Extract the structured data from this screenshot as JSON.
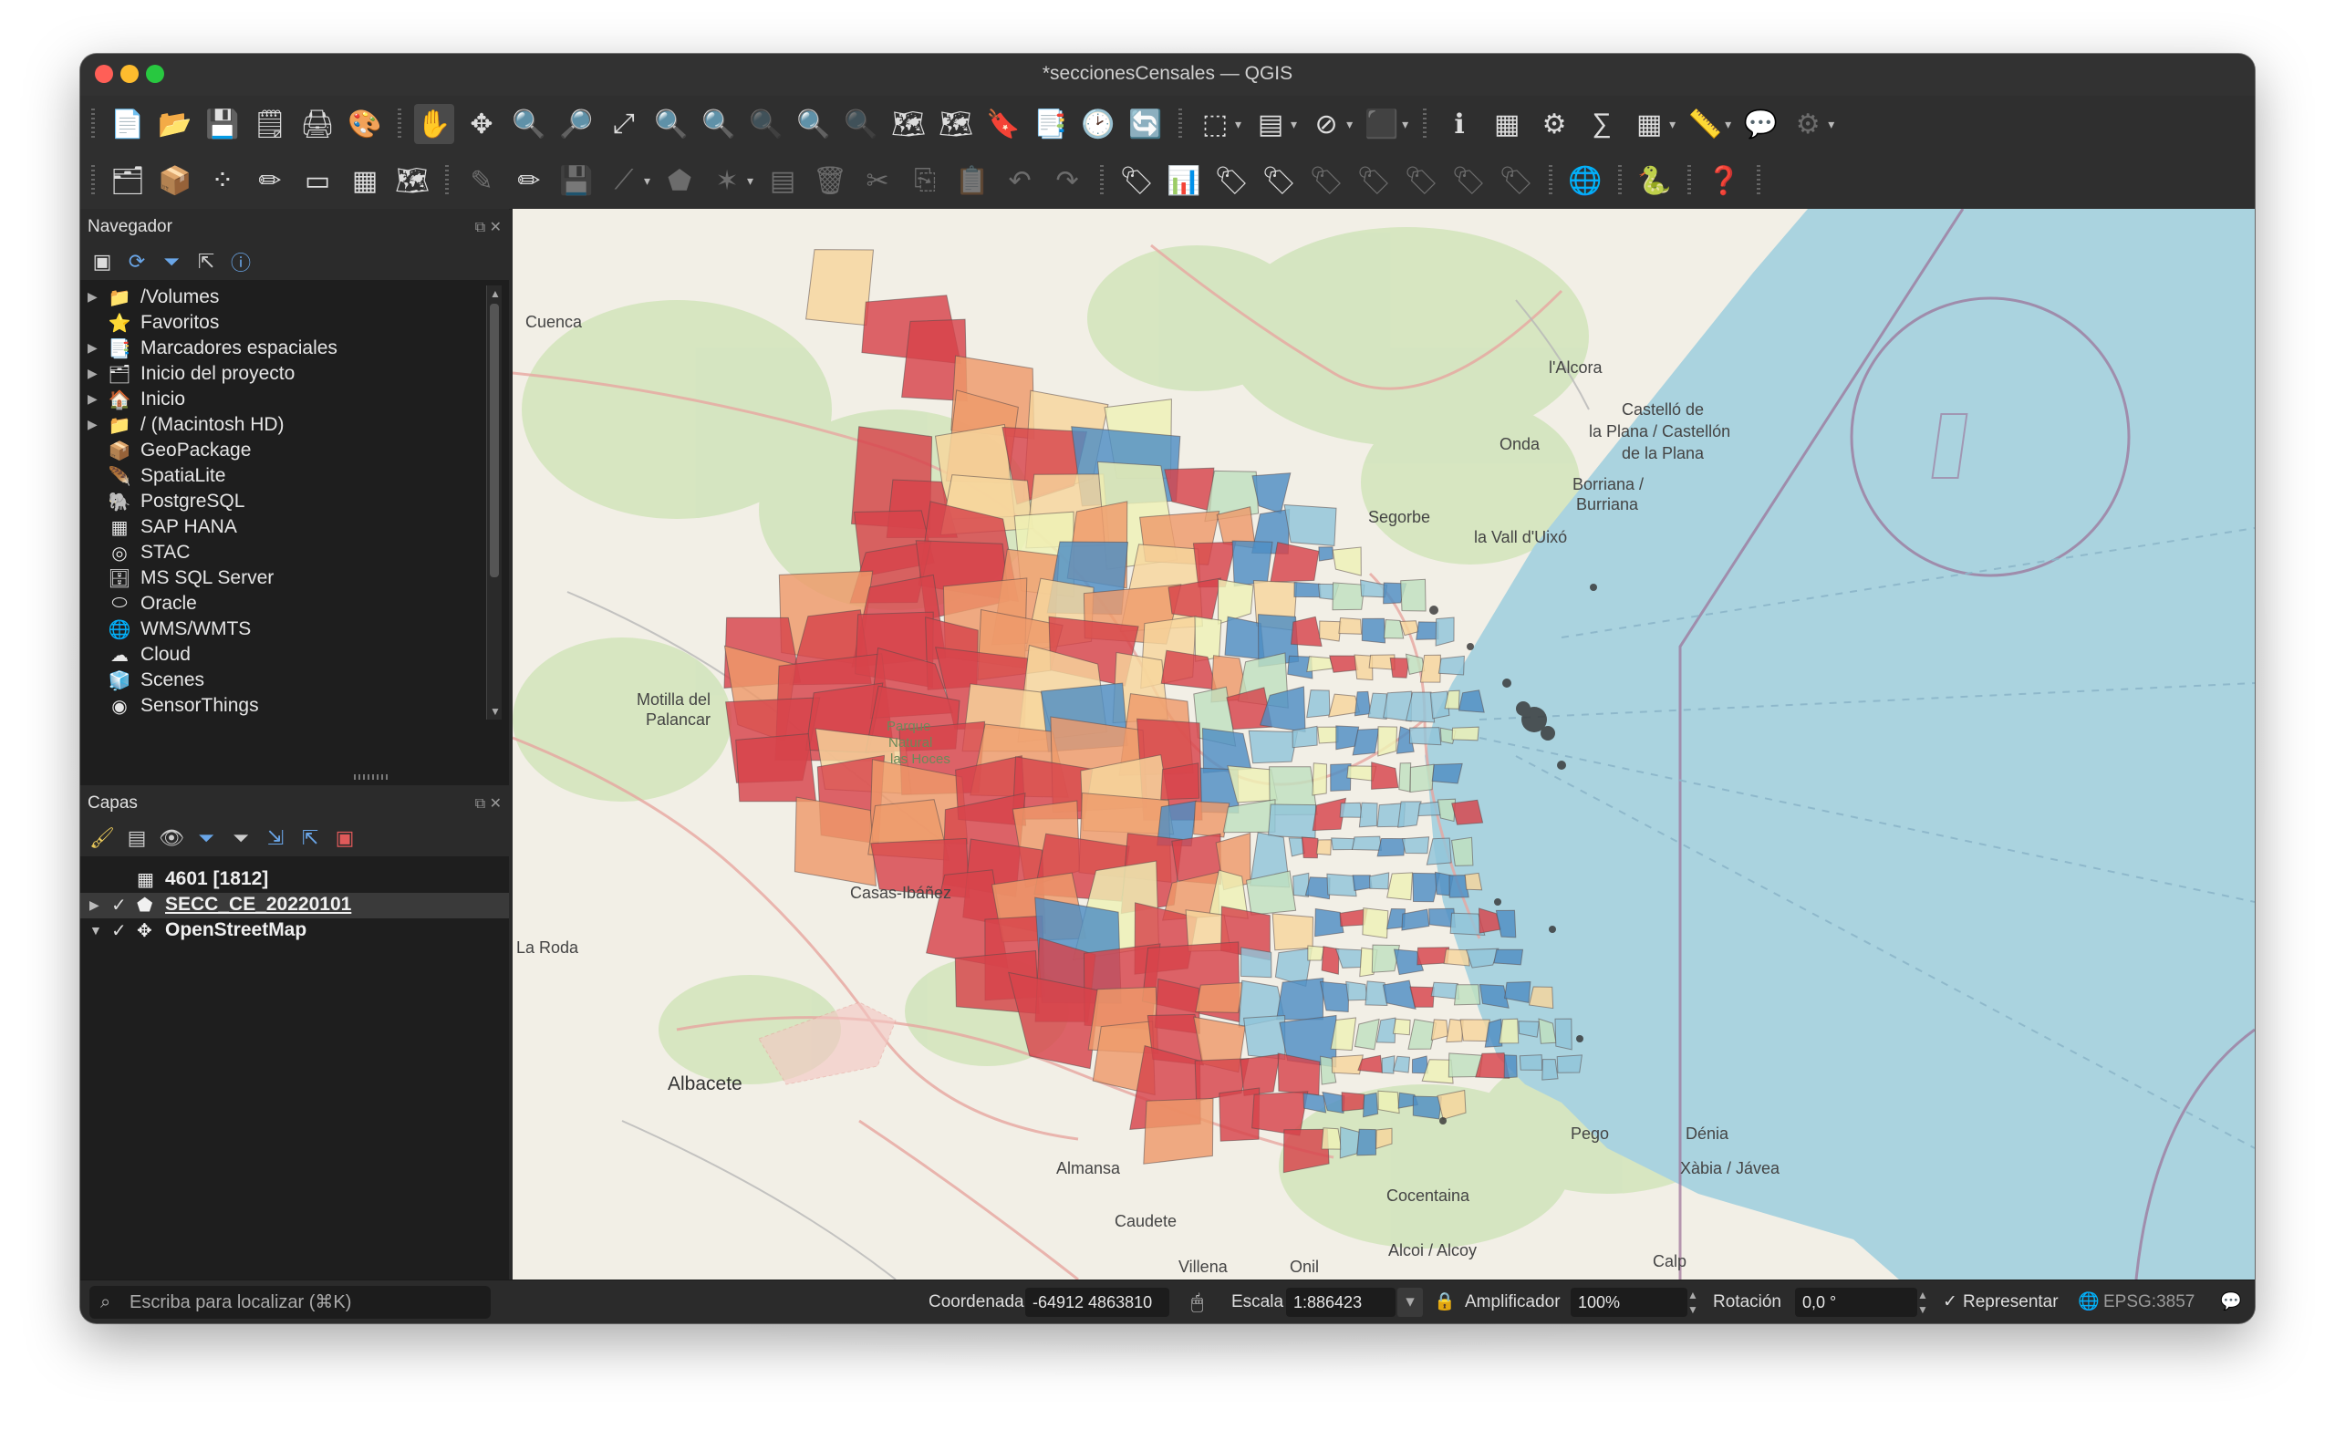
{
  "window": {
    "title": "*seccionesCensales — QGIS"
  },
  "navigator": {
    "title": "Navegador",
    "items": [
      {
        "label": "/Volumes",
        "icon": "folder-icon",
        "expandable": true
      },
      {
        "label": "Favoritos",
        "icon": "star-icon",
        "expandable": false
      },
      {
        "label": "Marcadores espaciales",
        "icon": "bookmark-icon",
        "expandable": true
      },
      {
        "label": "Inicio del proyecto",
        "icon": "project-home-icon",
        "expandable": true
      },
      {
        "label": "Inicio",
        "icon": "home-icon",
        "expandable": true
      },
      {
        "label": "/ (Macintosh HD)",
        "icon": "folder-icon",
        "expandable": true
      },
      {
        "label": "GeoPackage",
        "icon": "geopackage-icon",
        "expandable": false
      },
      {
        "label": "SpatiaLite",
        "icon": "spatialite-icon",
        "expandable": false
      },
      {
        "label": "PostgreSQL",
        "icon": "postgresql-icon",
        "expandable": false
      },
      {
        "label": "SAP HANA",
        "icon": "sap-hana-icon",
        "expandable": false
      },
      {
        "label": "STAC",
        "icon": "stac-icon",
        "expandable": false
      },
      {
        "label": "MS SQL Server",
        "icon": "mssql-icon",
        "expandable": false
      },
      {
        "label": "Oracle",
        "icon": "oracle-icon",
        "expandable": false
      },
      {
        "label": "WMS/WMTS",
        "icon": "wms-icon",
        "expandable": false
      },
      {
        "label": "Cloud",
        "icon": "cloud-icon",
        "expandable": false
      },
      {
        "label": "Scenes",
        "icon": "scenes-icon",
        "expandable": false
      },
      {
        "label": "SensorThings",
        "icon": "sensorthings-icon",
        "expandable": false
      }
    ]
  },
  "layers": {
    "title": "Capas",
    "items": [
      {
        "label": "4601 [1812]",
        "icon": "table-icon",
        "checked": false,
        "expandable": false,
        "selected": false
      },
      {
        "label": "SECC_CE_20220101",
        "icon": "polygon-layer-icon",
        "checked": true,
        "expandable": true,
        "selected": true
      },
      {
        "label": "OpenStreetMap",
        "icon": "xyz-tile-icon",
        "checked": true,
        "expandable": true,
        "selected": false
      }
    ]
  },
  "statusbar": {
    "search_placeholder": "Escriba para localizar (⌘K)",
    "coord_label": "Coordenada",
    "coord_value": "-64912  4863810",
    "scale_label": "Escala",
    "scale_value": "1:886423",
    "magnifier_label": "Amplificador",
    "magnifier_value": "100%",
    "rotation_label": "Rotación",
    "rotation_value": "0,0 °",
    "render_label": "Representar",
    "render_checked": true,
    "crs": "EPSG:3857"
  },
  "map_labels": {
    "cuenca": "Cuenca",
    "alcora": "l'Alcora",
    "castello": "Castelló de",
    "castello2": "la Plana / Castellón",
    "castello3": "de la Plana",
    "onda": "Onda",
    "borriana": "Borriana /",
    "borriana2": "Burriana",
    "segorbe": "Segorbe",
    "valldeuxo": "la Vall d'Uixó",
    "motilla": "Motilla del",
    "motilla2": "Palancar",
    "casasibanez": "Casas-Ibáñez",
    "laroda": "La Roda",
    "albacete": "Albacete",
    "almansa": "Almansa",
    "cocentaina": "Cocentaina",
    "alcoi": "Alcoi / Alcoy",
    "caudete": "Caudete",
    "villena": "Villena",
    "onil": "Onil",
    "calp": "Calp",
    "pego": "Pego",
    "denia": "Dénia",
    "xabia": "Xàbia / Jávea",
    "parque": "Parque",
    "parque2": "Natural",
    "parque3": "las Hoces"
  },
  "colors": {
    "choropleth": [
      "#d7434b",
      "#ee9a6a",
      "#f6d59c",
      "#eef2b6",
      "#bfe0c0",
      "#90c4d9",
      "#4e8ec3"
    ],
    "sea": "#aad3df",
    "land": "#f2efe6"
  }
}
